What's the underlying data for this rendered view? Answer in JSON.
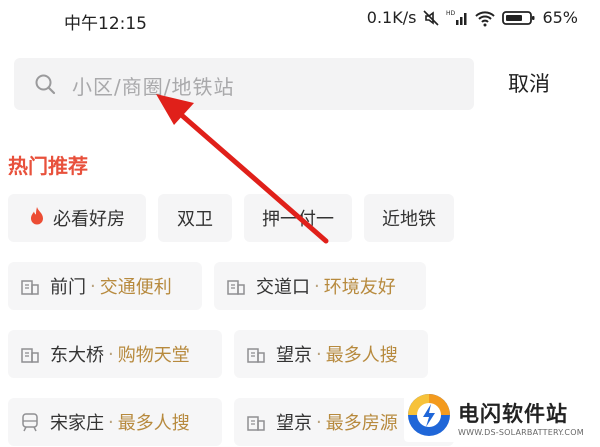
{
  "status_bar": {
    "time": "中午12:15",
    "net_speed": "0.1K/s",
    "battery": "65%"
  },
  "search": {
    "placeholder": "小区/商圈/地铁站",
    "cancel_label": "取消"
  },
  "section": {
    "title": "热门推荐"
  },
  "tags": [
    "必看好房",
    "双卫",
    "押一付一",
    "近地铁"
  ],
  "areas": [
    {
      "name": "前门",
      "tag": "交通便利",
      "icon": "building-icon"
    },
    {
      "name": "交道口",
      "tag": "环境友好",
      "icon": "building-icon"
    },
    {
      "name": "东大桥",
      "tag": "购物天堂",
      "icon": "building-icon"
    },
    {
      "name": "望京",
      "tag": "最多人搜",
      "icon": "building-icon"
    },
    {
      "name": "宋家庄",
      "tag": "最多人搜",
      "icon": "subway-icon"
    },
    {
      "name": "望京",
      "tag": "最多房源",
      "icon": "building-icon"
    }
  ],
  "separator": "·",
  "watermark": {
    "title": "电闪软件站",
    "url": "WWW.DS-SOLARBATTERY.COM"
  },
  "colors": {
    "accent": "#e8513c",
    "tag_text": "#b78a3e",
    "arrow": "#e0201a"
  }
}
